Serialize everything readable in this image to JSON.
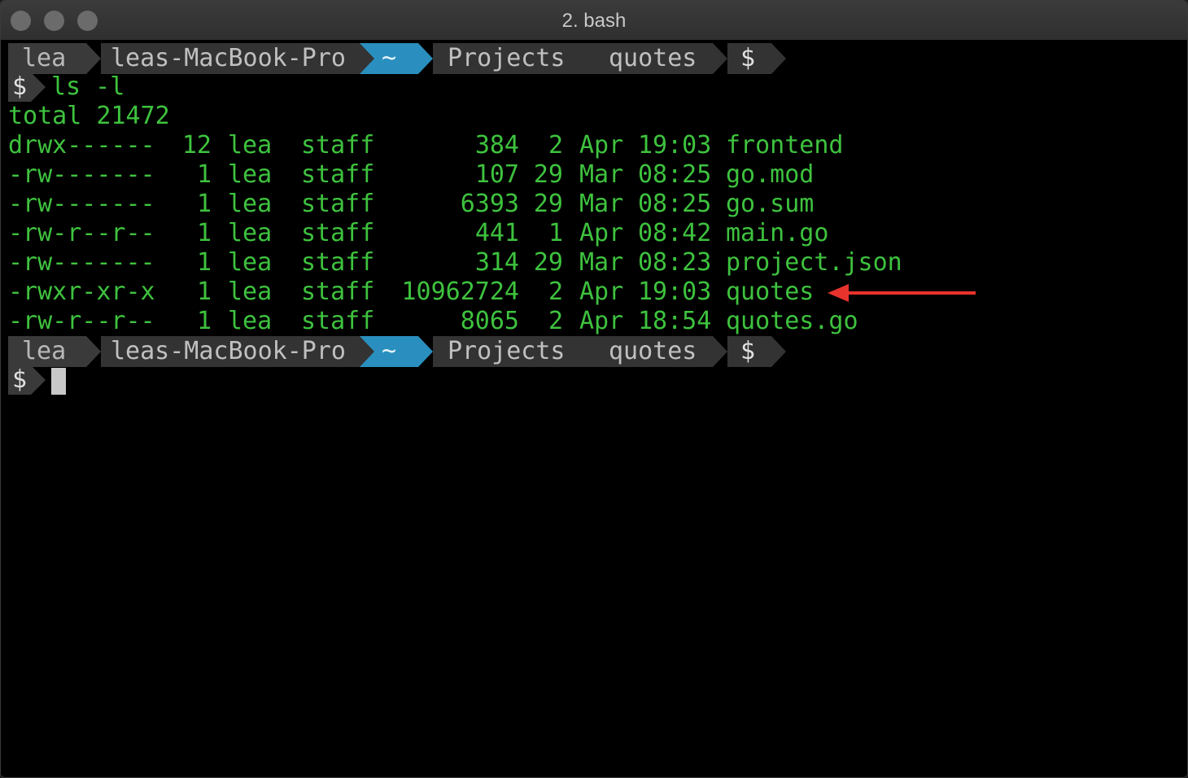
{
  "window": {
    "title": "2. bash"
  },
  "prompt": {
    "user": "lea",
    "host": "leas-MacBook-Pro",
    "home": "~",
    "dir1": "Projects",
    "dir2": "quotes",
    "symbol": "$"
  },
  "command": "ls -l",
  "total_line": "total 21472",
  "listing": [
    {
      "perms": "drwx------",
      "links": "12",
      "owner": "lea",
      "group": "staff",
      "size": "384",
      "day": "2",
      "month": "Apr",
      "time": "19:03",
      "name": "frontend"
    },
    {
      "perms": "-rw-------",
      "links": "1",
      "owner": "lea",
      "group": "staff",
      "size": "107",
      "day": "29",
      "month": "Mar",
      "time": "08:25",
      "name": "go.mod"
    },
    {
      "perms": "-rw-------",
      "links": "1",
      "owner": "lea",
      "group": "staff",
      "size": "6393",
      "day": "29",
      "month": "Mar",
      "time": "08:25",
      "name": "go.sum"
    },
    {
      "perms": "-rw-r--r--",
      "links": "1",
      "owner": "lea",
      "group": "staff",
      "size": "441",
      "day": "1",
      "month": "Apr",
      "time": "08:42",
      "name": "main.go"
    },
    {
      "perms": "-rw-------",
      "links": "1",
      "owner": "lea",
      "group": "staff",
      "size": "314",
      "day": "29",
      "month": "Mar",
      "time": "08:23",
      "name": "project.json"
    },
    {
      "perms": "-rwxr-xr-x",
      "links": "1",
      "owner": "lea",
      "group": "staff",
      "size": "10962724",
      "day": "2",
      "month": "Apr",
      "time": "19:03",
      "name": "quotes"
    },
    {
      "perms": "-rw-r--r--",
      "links": "1",
      "owner": "lea",
      "group": "staff",
      "size": "8065",
      "day": "2",
      "month": "Apr",
      "time": "18:54",
      "name": "quotes.go"
    }
  ],
  "colors": {
    "terminal_text": "#3ec23e",
    "prompt_blue": "#2a8fbf",
    "annotation_arrow": "#e8322c"
  },
  "annotation": {
    "icon": "red-arrow-icon",
    "points_to": "quotes"
  }
}
